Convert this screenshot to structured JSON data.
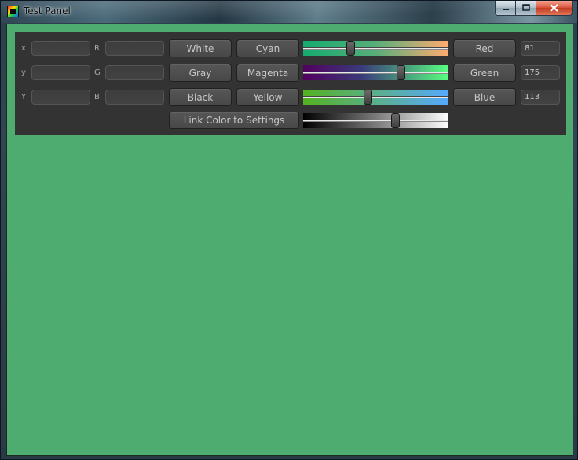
{
  "window": {
    "title": "Test Panel",
    "caption_buttons": [
      "minimize-icon",
      "maximize-icon",
      "close-icon"
    ]
  },
  "colors": {
    "background": "#4fac71",
    "panel": "#333333"
  },
  "panel": {
    "row_labels_left": [
      "x",
      "y",
      "Y"
    ],
    "row_labels_mid": [
      "R",
      "G",
      "B"
    ],
    "fields_left": [
      "",
      "",
      ""
    ],
    "fields_mid": [
      "",
      "",
      ""
    ],
    "preset_buttons": {
      "white": "White",
      "cyan": "Cyan",
      "gray": "Gray",
      "magenta": "Magenta",
      "black": "Black",
      "yellow": "Yellow"
    },
    "channel_buttons": {
      "red": "Red",
      "green": "Green",
      "blue": "Blue"
    },
    "channel_values": {
      "red": "81",
      "green": "175",
      "blue": "113"
    },
    "link_button": "Link Color to Settings",
    "slider_levels": {
      "red": 0.318,
      "green": 0.686,
      "blue": 0.443,
      "gray": 0.643
    }
  }
}
